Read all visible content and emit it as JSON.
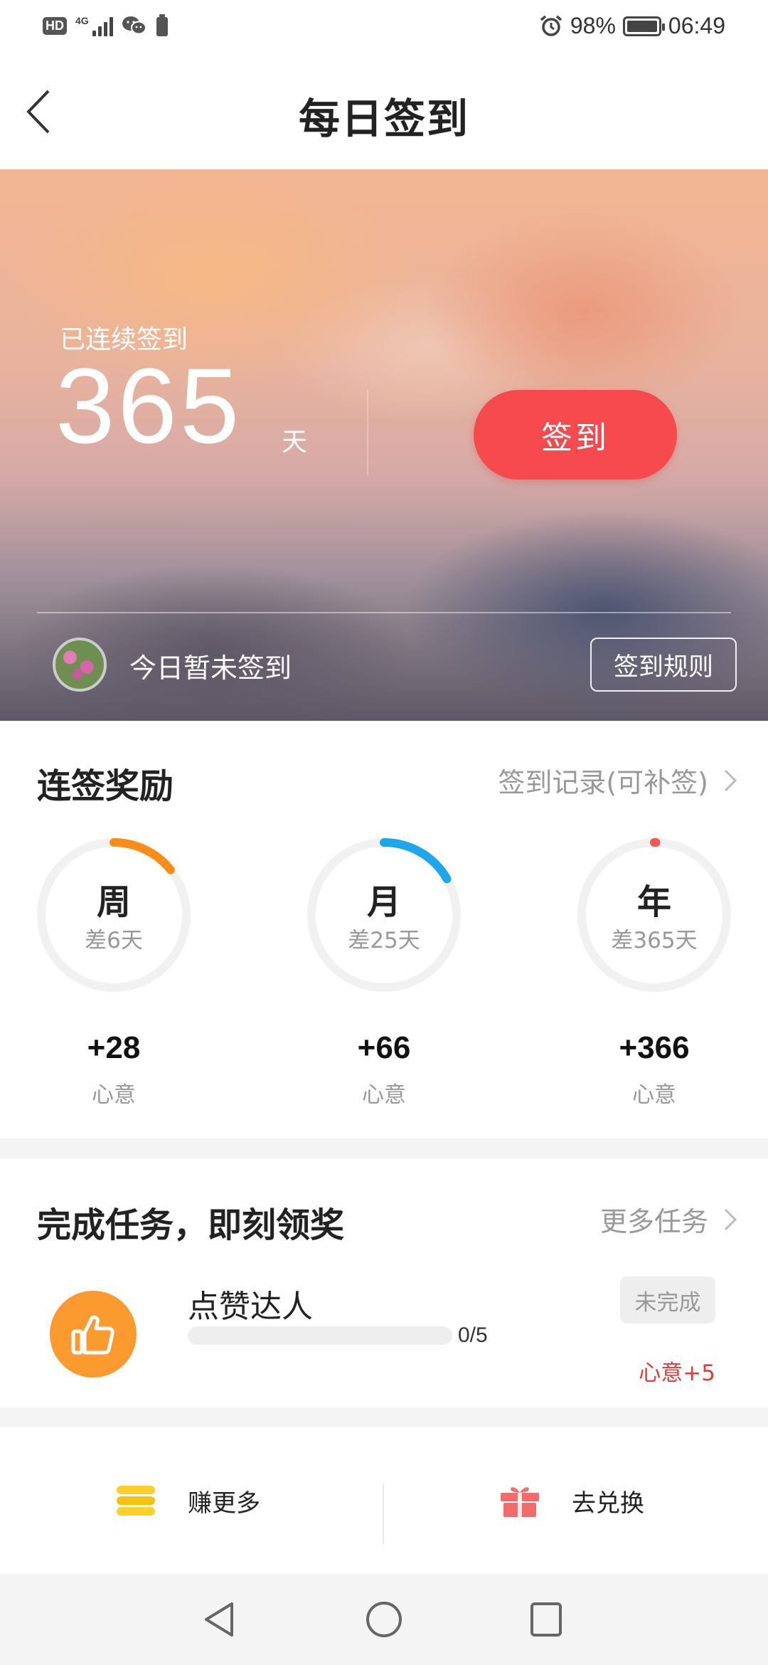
{
  "status_bar": {
    "hd": "HD",
    "network": "4G",
    "battery_percent": "98%",
    "time": "06:49",
    "icons": [
      "hd-icon",
      "signal-icon",
      "wechat-icon",
      "battery-small-icon",
      "alarm-icon",
      "battery-icon"
    ]
  },
  "header": {
    "title": "每日签到",
    "back_icon": "back-chevron-icon"
  },
  "hero": {
    "streak_label": "已连续签到",
    "streak_days": "365",
    "unit": "天",
    "checkin_button": "签到",
    "today_status": "今日暂未签到",
    "rules_button": "签到规则"
  },
  "rewards": {
    "title": "连签奖励",
    "record_link": "签到记录(可补签)",
    "accent_colors": [
      "#f88d1a",
      "#1ea6ea",
      "#f15a4d"
    ],
    "items": [
      {
        "period": "周",
        "remaining": "差6天",
        "points": "+28",
        "unit": "心意",
        "progress": 0.143
      },
      {
        "period": "月",
        "remaining": "差25天",
        "points": "+66",
        "unit": "心意",
        "progress": 0.167
      },
      {
        "period": "年",
        "remaining": "差365天",
        "points": "+366",
        "unit": "心意",
        "progress": 0.0
      }
    ]
  },
  "tasks": {
    "title": "完成任务，即刻领奖",
    "more_link": "更多任务",
    "items": [
      {
        "name": "点赞达人",
        "progress_text": "0/5",
        "progress": 0.0,
        "status": "未完成",
        "reward": "心意+5",
        "icon": "thumbs-up-icon"
      }
    ]
  },
  "action_bar": {
    "earn_more": "赚更多",
    "redeem": "去兑换",
    "icons": [
      "coins-icon",
      "gift-icon"
    ]
  },
  "system_nav": {
    "icons": [
      "nav-back-icon",
      "nav-home-icon",
      "nav-recents-icon"
    ]
  }
}
